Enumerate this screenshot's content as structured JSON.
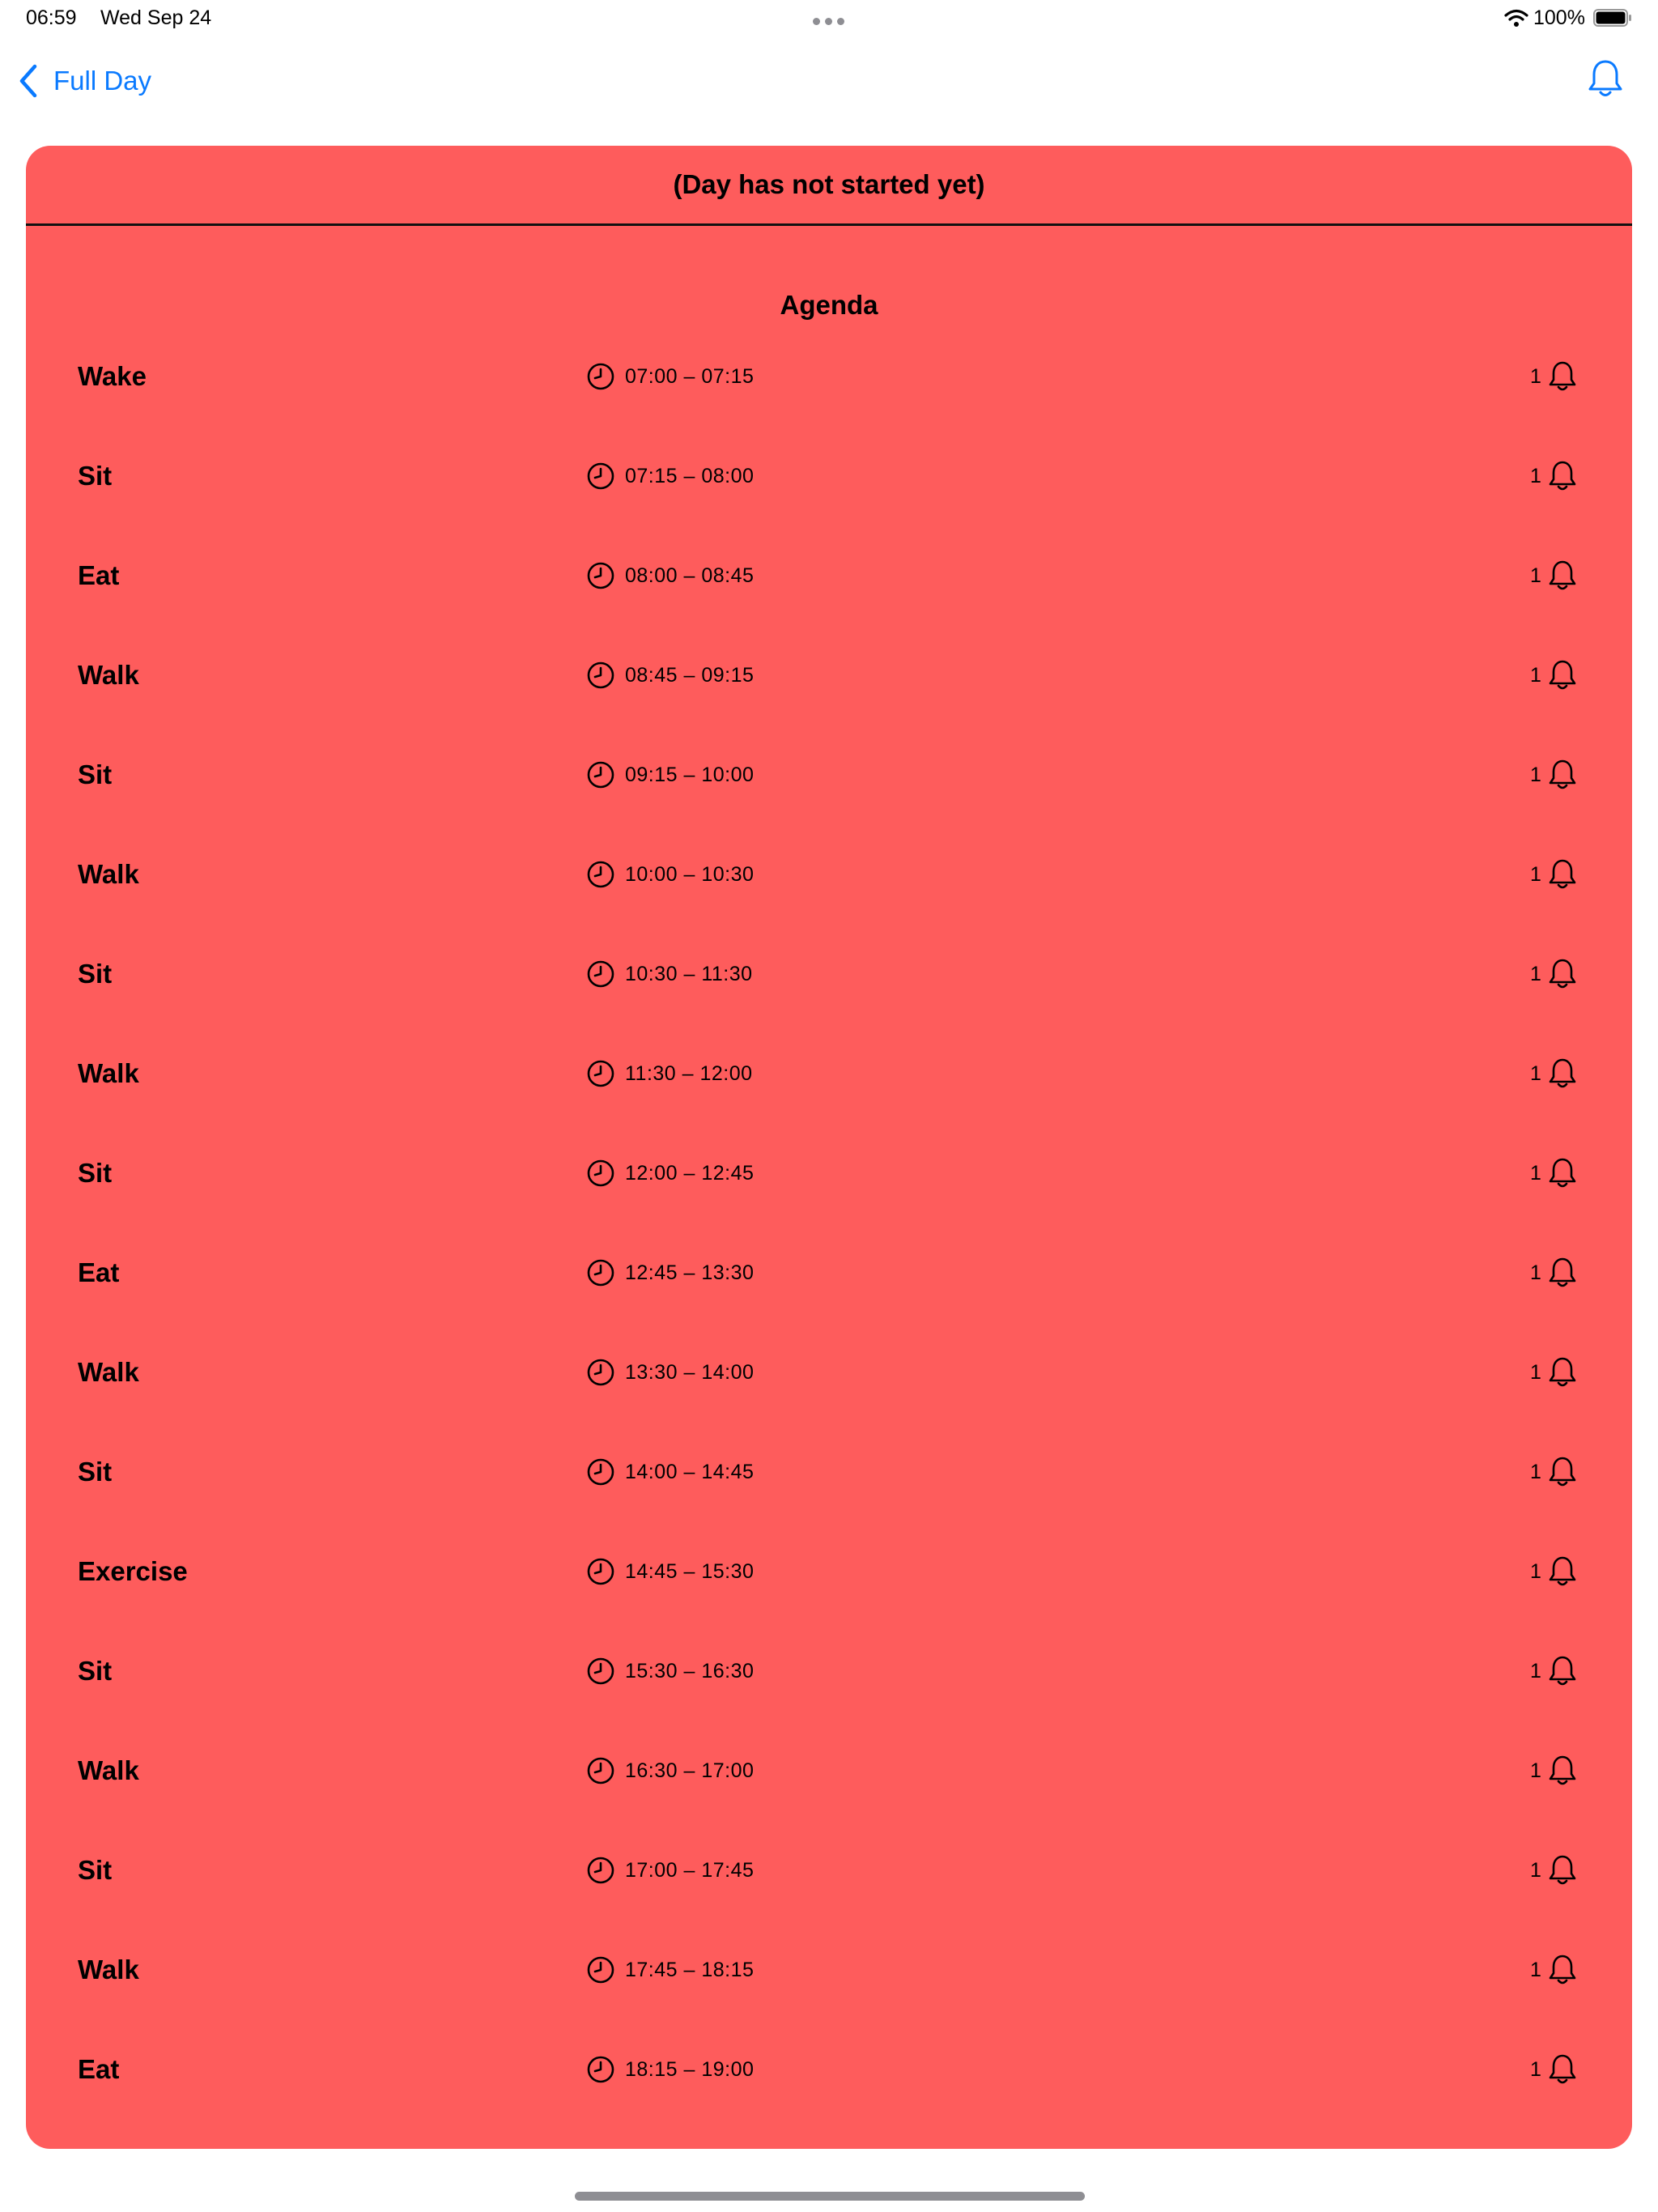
{
  "status_bar": {
    "time": "06:59",
    "date": "Wed Sep 24",
    "battery": "100%"
  },
  "nav": {
    "back_label": "Full Day",
    "accent_color": "#0a7aff"
  },
  "card": {
    "background_color": "#fe5c5c",
    "status_text": "(Day has not started yet)",
    "agenda_title": "Agenda"
  },
  "agenda": [
    {
      "name": "Wake",
      "time": "07:00 – 07:15",
      "alerts": "1"
    },
    {
      "name": "Sit",
      "time": "07:15 – 08:00",
      "alerts": "1"
    },
    {
      "name": "Eat",
      "time": "08:00 – 08:45",
      "alerts": "1"
    },
    {
      "name": "Walk",
      "time": "08:45 – 09:15",
      "alerts": "1"
    },
    {
      "name": "Sit",
      "time": "09:15 – 10:00",
      "alerts": "1"
    },
    {
      "name": "Walk",
      "time": "10:00 – 10:30",
      "alerts": "1"
    },
    {
      "name": "Sit",
      "time": "10:30 – 11:30",
      "alerts": "1"
    },
    {
      "name": "Walk",
      "time": "11:30 – 12:00",
      "alerts": "1"
    },
    {
      "name": "Sit",
      "time": "12:00 – 12:45",
      "alerts": "1"
    },
    {
      "name": "Eat",
      "time": "12:45 – 13:30",
      "alerts": "1"
    },
    {
      "name": "Walk",
      "time": "13:30 – 14:00",
      "alerts": "1"
    },
    {
      "name": "Sit",
      "time": "14:00 – 14:45",
      "alerts": "1"
    },
    {
      "name": "Exercise",
      "time": "14:45 – 15:30",
      "alerts": "1"
    },
    {
      "name": "Sit",
      "time": "15:30 – 16:30",
      "alerts": "1"
    },
    {
      "name": "Walk",
      "time": "16:30 – 17:00",
      "alerts": "1"
    },
    {
      "name": "Sit",
      "time": "17:00 – 17:45",
      "alerts": "1"
    },
    {
      "name": "Walk",
      "time": "17:45 – 18:15",
      "alerts": "1"
    },
    {
      "name": "Eat",
      "time": "18:15 – 19:00",
      "alerts": "1"
    }
  ]
}
